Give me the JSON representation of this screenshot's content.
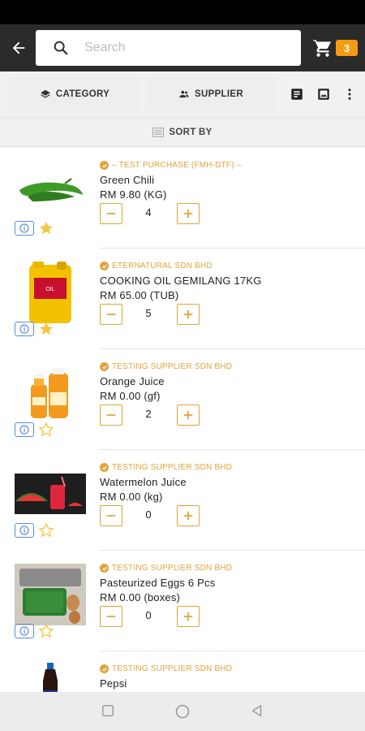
{
  "search": {
    "placeholder": "Search"
  },
  "cart": {
    "count": "3"
  },
  "filters": {
    "category_label": "CATEGORY",
    "supplier_label": "SUPPLIER",
    "sort_label": "SORT BY"
  },
  "colors": {
    "accent": "#e2a33b",
    "badge": "#f39c12",
    "topbar": "#2b2b2b",
    "info": "#5b8ed6",
    "star_filled": "#f5c542"
  },
  "products": [
    {
      "supplier": "– TEST PURCHASE (FMH-DTF) –",
      "name": "Green Chili",
      "price": "RM 9.80 (KG)",
      "qty": "4",
      "favorite": true,
      "image": "green-chili"
    },
    {
      "supplier": "ETERNATURAL SDN BHD",
      "name": "COOKING OIL GEMILANG 17KG",
      "price": "RM 65.00 (TUB)",
      "qty": "5",
      "favorite": true,
      "image": "cooking-oil"
    },
    {
      "supplier": "TESTING SUPPLIER SDN BHD",
      "name": "Orange Juice",
      "price": "RM 0.00 (gf)",
      "qty": "2",
      "favorite": false,
      "image": "orange-juice"
    },
    {
      "supplier": "TESTING SUPPLIER SDN BHD",
      "name": "Watermelon Juice",
      "price": "RM 0.00 (kg)",
      "qty": "0",
      "favorite": false,
      "image": "watermelon-juice"
    },
    {
      "supplier": "TESTING SUPPLIER SDN BHD",
      "name": "Pasteurized Eggs 6 Pcs",
      "price": "RM 0.00 (boxes)",
      "qty": "0",
      "favorite": false,
      "image": "eggs"
    },
    {
      "supplier": "TESTING SUPPLIER SDN BHD",
      "name": "Pepsi",
      "price": "",
      "qty": "",
      "favorite": false,
      "image": "pepsi"
    }
  ]
}
